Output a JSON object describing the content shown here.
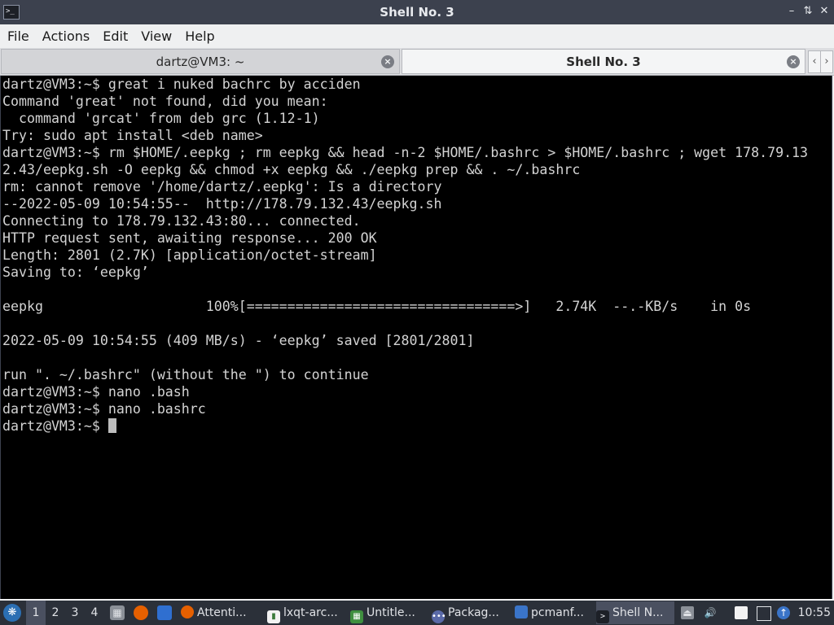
{
  "window": {
    "title": "Shell No. 3",
    "controls": [
      "minimize",
      "maximize",
      "close"
    ]
  },
  "menu": [
    "File",
    "Actions",
    "Edit",
    "View",
    "Help"
  ],
  "tabs": [
    {
      "label": "dartz@VM3: ~",
      "active": false
    },
    {
      "label": "Shell No. 3",
      "active": true
    }
  ],
  "terminal": {
    "lines": [
      "dartz@VM3:~$ great i nuked bachrc by acciden",
      "Command 'great' not found, did you mean:",
      "  command 'grcat' from deb grc (1.12-1)",
      "Try: sudo apt install <deb name>",
      "dartz@VM3:~$ rm $HOME/.eepkg ; rm eepkg && head -n-2 $HOME/.bashrc > $HOME/.bashrc ; wget 178.79.13",
      "2.43/eepkg.sh -O eepkg && chmod +x eepkg && ./eepkg prep && . ~/.bashrc",
      "rm: cannot remove '/home/dartz/.eepkg': Is a directory",
      "--2022-05-09 10:54:55--  http://178.79.132.43/eepkg.sh",
      "Connecting to 178.79.132.43:80... connected.",
      "HTTP request sent, awaiting response... 200 OK",
      "Length: 2801 (2.7K) [application/octet-stream]",
      "Saving to: ‘eepkg’",
      "",
      "eepkg                    100%[=================================>]   2.74K  --.-KB/s    in 0s",
      "",
      "2022-05-09 10:54:55 (409 MB/s) - ‘eepkg’ saved [2801/2801]",
      "",
      "run \". ~/.bashrc\" (without the \") to continue",
      "dartz@VM3:~$ nano .bash",
      "dartz@VM3:~$ nano .bashrc"
    ],
    "prompt": "dartz@VM3:~$ "
  },
  "taskbar": {
    "desktops": [
      "1",
      "2",
      "3",
      "4"
    ],
    "active_desktop": "1",
    "tasks": [
      {
        "label": "Attenti...",
        "icon": "firefox-icon"
      },
      {
        "label": "lxqt-arc...",
        "icon": "document-icon"
      },
      {
        "label": "Untitle...",
        "icon": "spreadsheet-icon"
      },
      {
        "label": "Packag...",
        "icon": "package-icon"
      },
      {
        "label": "pcmanf...",
        "icon": "folder-icon"
      },
      {
        "label": "Shell N...",
        "icon": "terminal-icon",
        "active": true
      }
    ],
    "clock": "10:55"
  }
}
